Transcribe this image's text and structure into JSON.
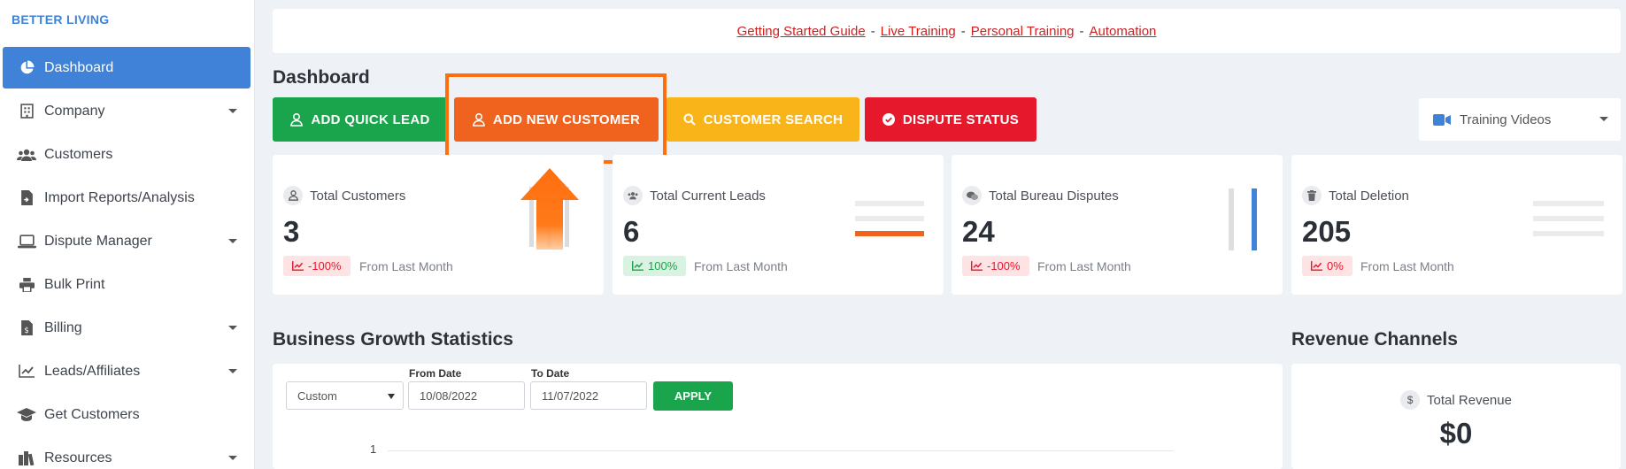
{
  "brand": "BETTER LIVING",
  "sidebar": {
    "items": [
      {
        "label": "Dashboard",
        "icon": "pie-chart-icon",
        "active": true,
        "has_caret": false
      },
      {
        "label": "Company",
        "icon": "building-icon",
        "has_caret": true
      },
      {
        "label": "Customers",
        "icon": "users-icon",
        "has_caret": false
      },
      {
        "label": "Import Reports/Analysis",
        "icon": "file-import-icon",
        "has_caret": false
      },
      {
        "label": "Dispute Manager",
        "icon": "laptop-icon",
        "has_caret": true
      },
      {
        "label": "Bulk Print",
        "icon": "printer-icon",
        "has_caret": false
      },
      {
        "label": "Billing",
        "icon": "invoice-icon",
        "has_caret": true
      },
      {
        "label": "Leads/Affiliates",
        "icon": "line-chart-icon",
        "has_caret": true
      },
      {
        "label": "Get Customers",
        "icon": "graduation-cap-icon",
        "has_caret": false
      },
      {
        "label": "Resources",
        "icon": "books-icon",
        "has_caret": true
      }
    ]
  },
  "links": {
    "getting_started": "Getting Started Guide",
    "live_training": "Live Training",
    "personal_training": "Personal Training",
    "automation": "Automation",
    "separator": "-"
  },
  "dashboard": {
    "title": "Dashboard",
    "buttons": {
      "add_quick_lead": "ADD QUICK LEAD",
      "add_new_customer": "ADD NEW CUSTOMER",
      "customer_search": "CUSTOMER SEARCH",
      "dispute_status": "DISPUTE STATUS"
    },
    "training_videos": "Training Videos"
  },
  "stats": [
    {
      "title": "Total Customers",
      "value": "3",
      "badge": "-100%",
      "badge_type": "red",
      "from": "From Last Month",
      "icon": "user-icon"
    },
    {
      "title": "Total Current Leads",
      "value": "6",
      "badge": "100%",
      "badge_type": "green",
      "from": "From Last Month",
      "icon": "users-icon"
    },
    {
      "title": "Total Bureau Disputes",
      "value": "24",
      "badge": "-100%",
      "badge_type": "red",
      "from": "From Last Month",
      "icon": "chat-icon"
    },
    {
      "title": "Total Deletion",
      "value": "205",
      "badge": "0%",
      "badge_type": "red",
      "from": "From Last Month",
      "icon": "trash-icon"
    }
  ],
  "growth": {
    "title": "Business Growth Statistics",
    "range_select": "Custom",
    "from_label": "From Date",
    "from_value": "10/08/2022",
    "to_label": "To Date",
    "to_value": "11/07/2022",
    "apply": "APPLY",
    "y_tick": "1"
  },
  "revenue": {
    "title": "Revenue Channels",
    "label": "Total Revenue",
    "value": "$0"
  },
  "colors": {
    "primary": "#3f82d8",
    "green": "#1aa54c",
    "orange": "#f0631f",
    "yellow": "#f9b41a",
    "red": "#e5192b",
    "highlight": "#ff6e0f"
  }
}
